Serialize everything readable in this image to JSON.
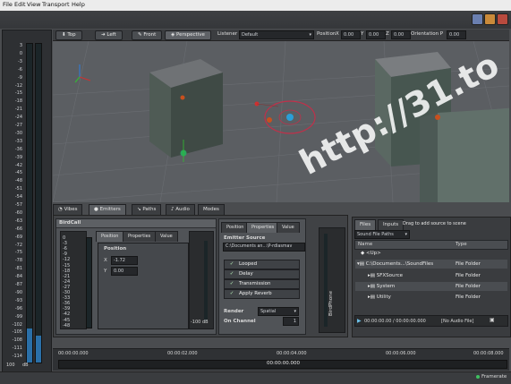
{
  "menu": {
    "file": "File",
    "edit": "Edit",
    "view": "View",
    "transport": "Transport",
    "help": "Help"
  },
  "window_buttons": [
    {
      "icon": "restore-icon",
      "color": "#6a7fb0"
    },
    {
      "icon": "minimize-icon",
      "color": "#c98a3a"
    },
    {
      "icon": "close-icon",
      "color": "#b84a3e"
    }
  ],
  "left_meters": {
    "labels": [
      "3",
      "0",
      "-3",
      "-6",
      "-9",
      "-12",
      "-15",
      "-18",
      "-21",
      "-24",
      "-27",
      "-30",
      "-33",
      "-36",
      "-39",
      "-42",
      "-45",
      "-48",
      "-51",
      "-54",
      "-57",
      "-60",
      "-63",
      "-66",
      "-69",
      "-72",
      "-75",
      "-78",
      "-81",
      "-84",
      "-87",
      "-90",
      "-93",
      "-96",
      "-99",
      "-102",
      "-105",
      "-108",
      "-111",
      "-114"
    ],
    "bottom_value": "100",
    "bottom_unit": "dB"
  },
  "viewport_toolbar": {
    "views": [
      "Top",
      "Left",
      "Front",
      "Perspective"
    ],
    "active_view": "Perspective",
    "listener_label": "Listener",
    "listener_value": "Default",
    "position_label": "Position",
    "x_label": "X",
    "x_value": "0.00",
    "y_label": "Y",
    "y_value": "0.00",
    "z_label": "Z",
    "z_value": "0.00",
    "orientation_label": "Orientation P",
    "orientation_value": "0.00"
  },
  "watermark_text": "http://31.to",
  "panel_tabs": [
    "Vibes",
    "Emitters",
    "Paths",
    "Audio",
    "Modes"
  ],
  "active_tab": "Emitters",
  "emitter_panel": {
    "name": "BirdCall",
    "subtabs": [
      "Position",
      "Properties",
      "Value"
    ],
    "section_label": "Position",
    "x_label": "X",
    "x_value": "-1.72",
    "y_label": "Y",
    "y_value": "0.00",
    "scale_labels": [
      "0",
      "-3",
      "-6",
      "-9",
      "-12",
      "-15",
      "-18",
      "-21",
      "-24",
      "-27",
      "-30",
      "-33",
      "-36",
      "-39",
      "-42",
      "-45",
      "-48"
    ],
    "meter_value": "-100",
    "meter_unit": "dB"
  },
  "emitter_source_panel": {
    "subtabs": [
      "Position",
      "Properties",
      "Value"
    ],
    "source_label": "Emitter Source",
    "source_value": "C:\\Documents an...\\P-rdlasmav",
    "buttons": [
      "Looped",
      "Delay",
      "Transmission",
      "Apply Reverb"
    ],
    "render_label": "Render",
    "render_value": "Spatial",
    "channel_label": "On Channel",
    "channel_value": "1",
    "side_label": "BirdPhone"
  },
  "files_panel": {
    "tabs": [
      "Files",
      "Inputs"
    ],
    "hint": "Drag to add source to scene",
    "filter_label": "Sound File Paths",
    "col_name": "Name",
    "col_type": "Type",
    "rows": [
      {
        "name": "<Up>",
        "type": ""
      },
      {
        "name": "C:\\Documents...\\SoundFiles",
        "type": "File Folder"
      },
      {
        "name": "SFXSource",
        "type": "File Folder"
      },
      {
        "name": "System",
        "type": "File Folder"
      },
      {
        "name": "Utility",
        "type": "File Folder"
      }
    ],
    "player_time": "00:00:00.00 / 00:00:00.000",
    "player_file": "[No Audio File]"
  },
  "timeline": {
    "ticks": [
      "00:00:00.000",
      "00:00:02.000",
      "00:00:04.000",
      "00:00:06.000",
      "00:00:08.000"
    ],
    "current_time": "00:00:00.000"
  },
  "status": {
    "right_text": "Framerate"
  }
}
